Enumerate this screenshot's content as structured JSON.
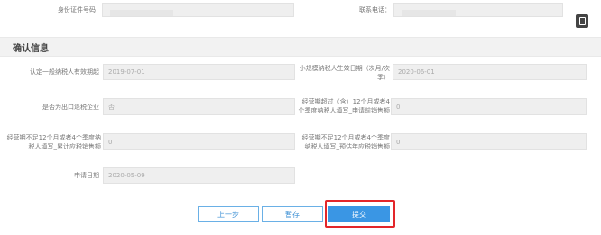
{
  "top_row": {
    "id_label": "身份证件号码",
    "phone_label": "联系电话："
  },
  "section": {
    "title": "确认信息"
  },
  "fields": {
    "recognition_date_label": "认定一般纳税人有效期起",
    "recognition_date_value": "2019-07-01",
    "effective_date_label": "小规模纳税人生效日期（次月/次季）",
    "effective_date_value": "2020-06-01",
    "export_label": "是否为出口退税企业",
    "export_value": "否",
    "past12_label": "经营期超过（含）12个月或者4个季度纳税人填写_申请前销售额",
    "past12_value": "0",
    "under12_cum_label": "经营期不足12个月或者4个季度纳税人填写_累计应税销售额",
    "under12_cum_value": "0",
    "under12_est_label": "经营期不足12个月或者4个季度纳税人填写_预估年应税销售额",
    "under12_est_value": "0",
    "apply_date_label": "申请日期",
    "apply_date_value": "2020-05-09"
  },
  "buttons": {
    "prev": "上一步",
    "save": "暂存",
    "submit": "提交"
  },
  "colors": {
    "accent": "#3a96e4",
    "highlight": "#e3262a",
    "section_bg": "#f2f2f2"
  },
  "icons": {
    "sidebar": "book-icon"
  }
}
